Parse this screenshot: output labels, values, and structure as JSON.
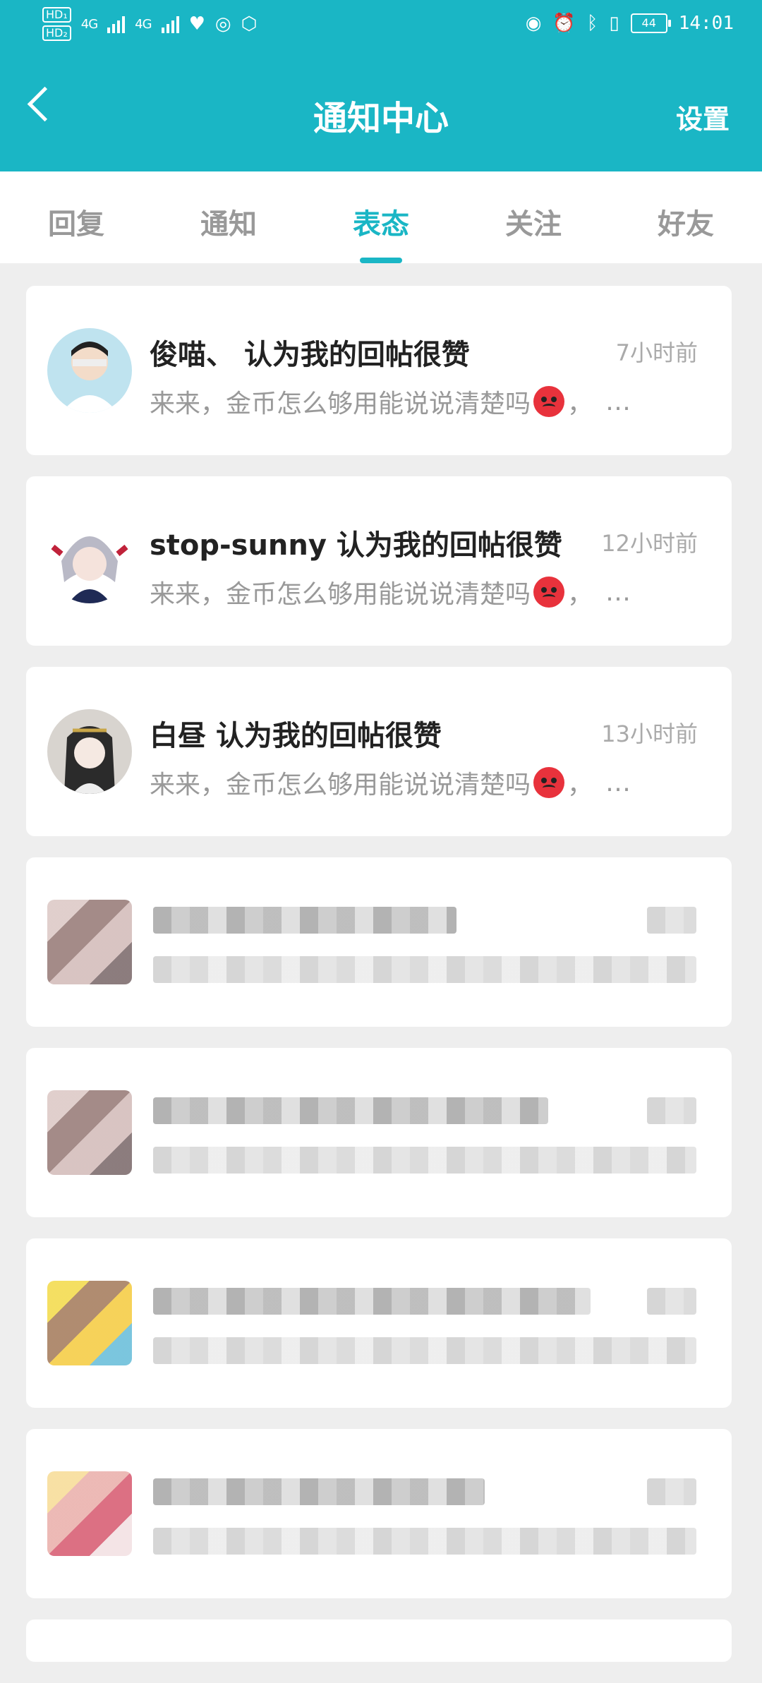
{
  "status_bar": {
    "hd1": "HD₁",
    "hd2": "HD₂",
    "signal1": "4G",
    "signal2": "4G",
    "battery": "44",
    "time": "14:01"
  },
  "header": {
    "title": "通知中心",
    "settings_label": "设置",
    "background_color": "#1ab6c5"
  },
  "tabs": [
    {
      "label": "回复"
    },
    {
      "label": "通知"
    },
    {
      "label": "表态"
    },
    {
      "label": "关注"
    },
    {
      "label": "好友"
    }
  ],
  "active_tab": "表态",
  "notifications": [
    {
      "user": "俊喵、",
      "action": "认为我的回帖很赞",
      "time": "7小时前",
      "preview": "来来，金币怎么够用能说说清楚吗",
      "suffix": "，",
      "ellipsis": "…"
    },
    {
      "user": "stop-sunny",
      "action": "认为我的回帖很赞",
      "time": "12小时前",
      "preview": "来来，金币怎么够用能说说清楚吗",
      "suffix": "，",
      "ellipsis": "…"
    },
    {
      "user": "白昼",
      "action": "认为我的回帖很赞",
      "time": "13小时前",
      "preview": "来来，金币怎么够用能说说清楚吗",
      "suffix": "，",
      "ellipsis": "…"
    }
  ]
}
